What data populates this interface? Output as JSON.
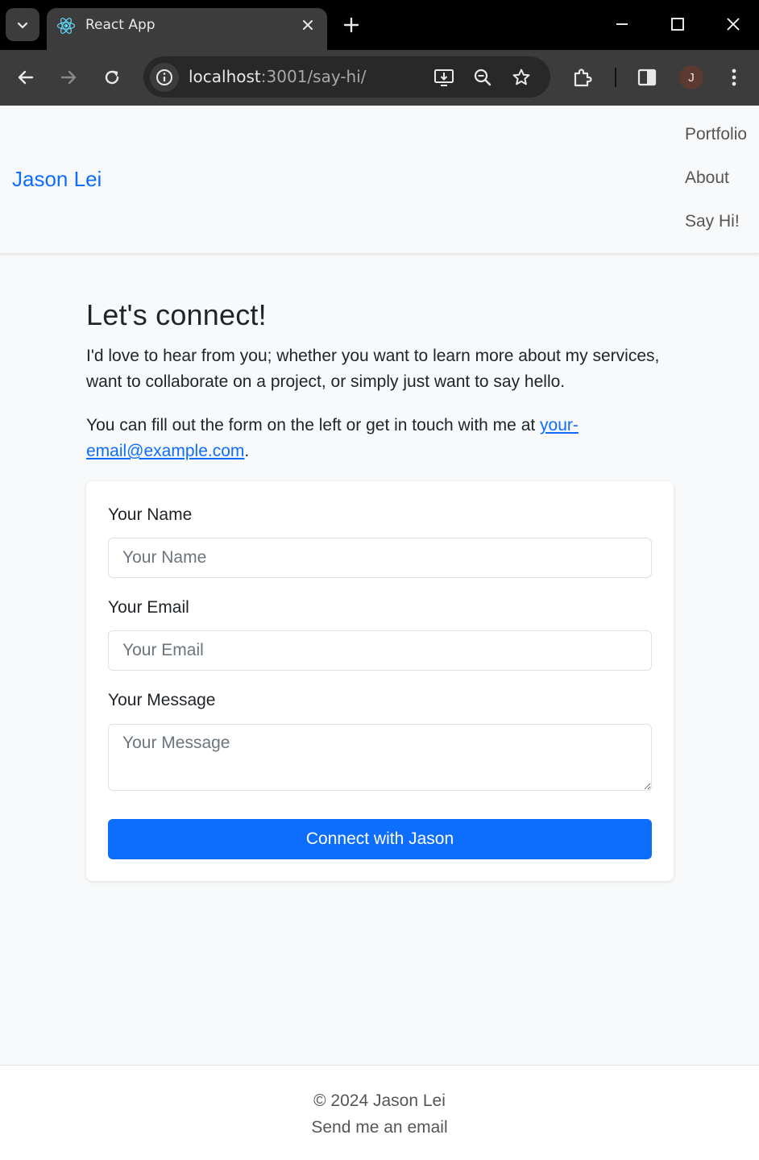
{
  "browser": {
    "tab": {
      "title": "React App",
      "favicon": "react-logo-icon"
    },
    "address_bar": {
      "host": "localhost",
      "rest": ":3001/say-hi/"
    },
    "profile_initial": "J",
    "icons": [
      "tab-search-icon",
      "close-icon",
      "plus-icon",
      "minimize-icon",
      "maximize-icon",
      "window-close-icon",
      "back-arrow-icon",
      "forward-arrow-icon",
      "reload-icon",
      "site-info-icon",
      "install-app-icon",
      "zoom-icon",
      "bookmark-star-icon",
      "extensions-icon",
      "side-panel-icon",
      "more-vert-icon"
    ]
  },
  "navbar": {
    "brand": "Jason Lei",
    "links": [
      {
        "label": "Portfolio"
      },
      {
        "label": "About"
      },
      {
        "label": "Say Hi!"
      }
    ]
  },
  "main": {
    "title": "Let's connect!",
    "intro": "I'd love to hear from you; whether you want to learn more about my services, want to collaborate on a project, or simply just want to say hello.",
    "contact_prefix": "You can fill out the form on the left or get in touch with me at ",
    "contact_email": "your-email@example.com",
    "contact_suffix": "."
  },
  "form": {
    "name_label": "Your Name",
    "name_placeholder": "Your Name",
    "name_value": "",
    "email_label": "Your Email",
    "email_placeholder": "Your Email",
    "email_value": "",
    "message_label": "Your Message",
    "message_placeholder": "Your Message",
    "message_value": "",
    "submit_label": "Connect with Jason"
  },
  "footer": {
    "copyright": "© 2024 Jason Lei",
    "email_link": "Send me an email"
  },
  "colors": {
    "accent": "#0d6efd",
    "page_bg": "#f8f9fa",
    "chrome_dark": "#3c3c3c"
  }
}
